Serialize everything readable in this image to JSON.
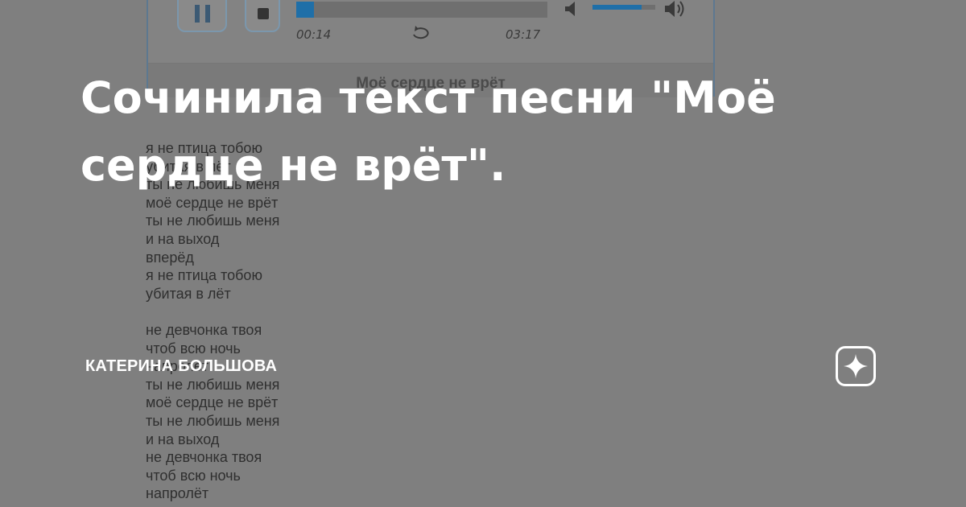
{
  "player": {
    "elapsed": "00:14",
    "total": "03:17",
    "progress_fraction": 0.07,
    "volume_fraction": 0.78,
    "track_title": "Моё сердце не врёт",
    "accent_color": "#1f6fa8"
  },
  "lyrics": [
    "я не птица тобою",
    "убитая в лёт",
    "ты не любишь меня",
    "моё сердце не врёт",
    "ты не любишь меня",
    "и на выход",
    "вперёд",
    "я не птица тобою",
    "убитая в лёт",
    "",
    "не девчонка твоя",
    "чтоб всю ночь",
    "напролёт",
    "ты не любишь меня",
    "моё сердце не врёт",
    "ты не любишь меня",
    "и на выход",
    "не девчонка твоя",
    "чтоб всю ночь",
    "напролёт"
  ],
  "article": {
    "title": "Сочинила текст песни \"Моё сердце не врёт\".",
    "author": "КАТЕРИНА БОЛЬШОВА"
  },
  "icons": {
    "play_pause": "pause-icon",
    "stop": "stop-icon",
    "repeat": "repeat-icon",
    "volume_low": "volume-low-icon",
    "volume_high": "volume-high-icon",
    "brand": "zen-star-icon"
  }
}
